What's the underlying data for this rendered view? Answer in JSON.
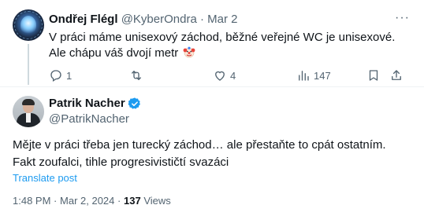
{
  "reply": {
    "author_name": "Ondřej Flégl",
    "handle": "@KyberOndra",
    "separator": "·",
    "date": "Mar 2",
    "text": "V práci máme unisexový záchod, běžné veřejné WC je unisexové. Ale chápu váš dvojí metr",
    "emoji": "clown-face-icon",
    "more_label": "···",
    "actions": {
      "reply_count": "1",
      "retweet_count": "",
      "like_count": "4",
      "view_count": "147"
    }
  },
  "tweet": {
    "author_name": "Patrik Nacher",
    "handle": "@PatrikNacher",
    "verified": true,
    "text": "Mějte v práci třeba jen turecký záchod… ale přestaňte to cpát ostatním. Fakt zoufalci, tihle progresivističtí svazáci",
    "translate_label": "Translate post",
    "time": "1:48 PM",
    "date": "Mar 2, 2024",
    "separator": "·",
    "views_count": "137",
    "views_label": "Views"
  },
  "colors": {
    "accent": "#1d9bf0",
    "muted": "#536471",
    "text": "#0f1419",
    "divider": "#eff3f4"
  }
}
